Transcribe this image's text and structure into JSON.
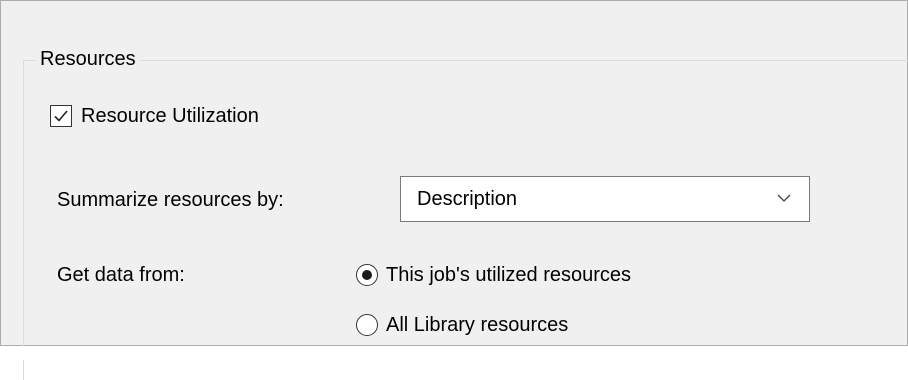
{
  "resources_group": {
    "title": "Resources",
    "utilization_checkbox": {
      "label": "Resource Utilization",
      "checked": true
    },
    "summarize": {
      "label": "Summarize resources by:",
      "selected_value": "Description"
    },
    "get_data": {
      "label": "Get data from:",
      "options": [
        {
          "label": "This job's utilized resources",
          "selected": true
        },
        {
          "label": "All Library resources",
          "selected": false
        }
      ]
    }
  },
  "colors": {
    "panel_background": "#f0f0f0",
    "control_border": "#7a7a7a",
    "text": "#000000"
  },
  "icons": {
    "checkbox": "checkmark-icon",
    "dropdown": "chevron-down-icon"
  }
}
